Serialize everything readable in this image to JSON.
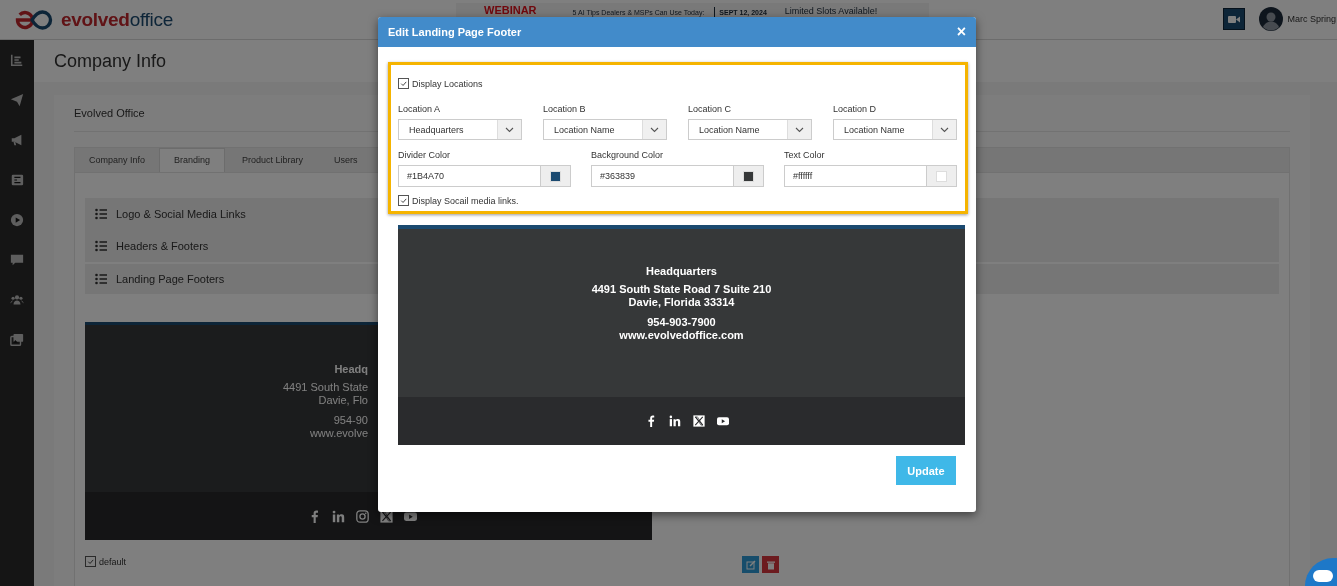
{
  "header": {
    "logo": {
      "part_1": "evolved",
      "part_2": "office"
    },
    "banner": {
      "title": "WEBINAR",
      "tagline": "5 AI Tips Dealers & MSPs Can Use Today:",
      "date": "SEPT 12, 2024",
      "note": "Limited Slots Available!"
    },
    "user_name": "Marc Spring"
  },
  "page": {
    "title": "Company Info",
    "company": "Evolved Office",
    "tabs": [
      {
        "label": "Company Info",
        "selected": false
      },
      {
        "label": "Branding",
        "selected": true
      },
      {
        "label": "Product Library",
        "selected": false
      },
      {
        "label": "Users",
        "selected": false
      }
    ],
    "sections": [
      {
        "label": "Logo & Social Media Links"
      },
      {
        "label": "Headers & Footers"
      },
      {
        "label": "Landing Page Footers"
      }
    ],
    "footer_preview": {
      "lines": [
        {
          "kind": "name",
          "text": "Headq"
        },
        {
          "kind": "address",
          "text": "4491 South State"
        },
        {
          "kind": "address",
          "text": "Davie, Flo"
        },
        {
          "kind": "phone",
          "text": "954-90"
        },
        {
          "kind": "website",
          "text": "www.evolve"
        }
      ],
      "default": {
        "label": "default",
        "checked": true
      }
    }
  },
  "modal": {
    "title": "Edit Landing Page Footer",
    "close": "×",
    "display_locations": {
      "label": "Display Locations",
      "checked": true
    },
    "locations": [
      {
        "label": "Location A",
        "value": "Headquarters"
      },
      {
        "label": "Location B",
        "value": "Location Name"
      },
      {
        "label": "Location C",
        "value": "Location Name"
      },
      {
        "label": "Location D",
        "value": "Location Name"
      }
    ],
    "colors": [
      {
        "kind": "divider",
        "label": "Divider Color",
        "value": "#1B4A70"
      },
      {
        "kind": "background",
        "label": "Background Color",
        "value": "#363839"
      },
      {
        "kind": "text",
        "label": "Text Color",
        "value": "#ffffff"
      }
    ],
    "display_social": {
      "label": "Display Socail media links.",
      "checked": true
    },
    "preview": {
      "name": "Headquarters",
      "address": [
        "4491 South State Road 7 Suite 210",
        "Davie, Florida 33314"
      ],
      "phone": "954-903-7900",
      "website": "www.evolvedoffice.com"
    },
    "update": "Update"
  }
}
